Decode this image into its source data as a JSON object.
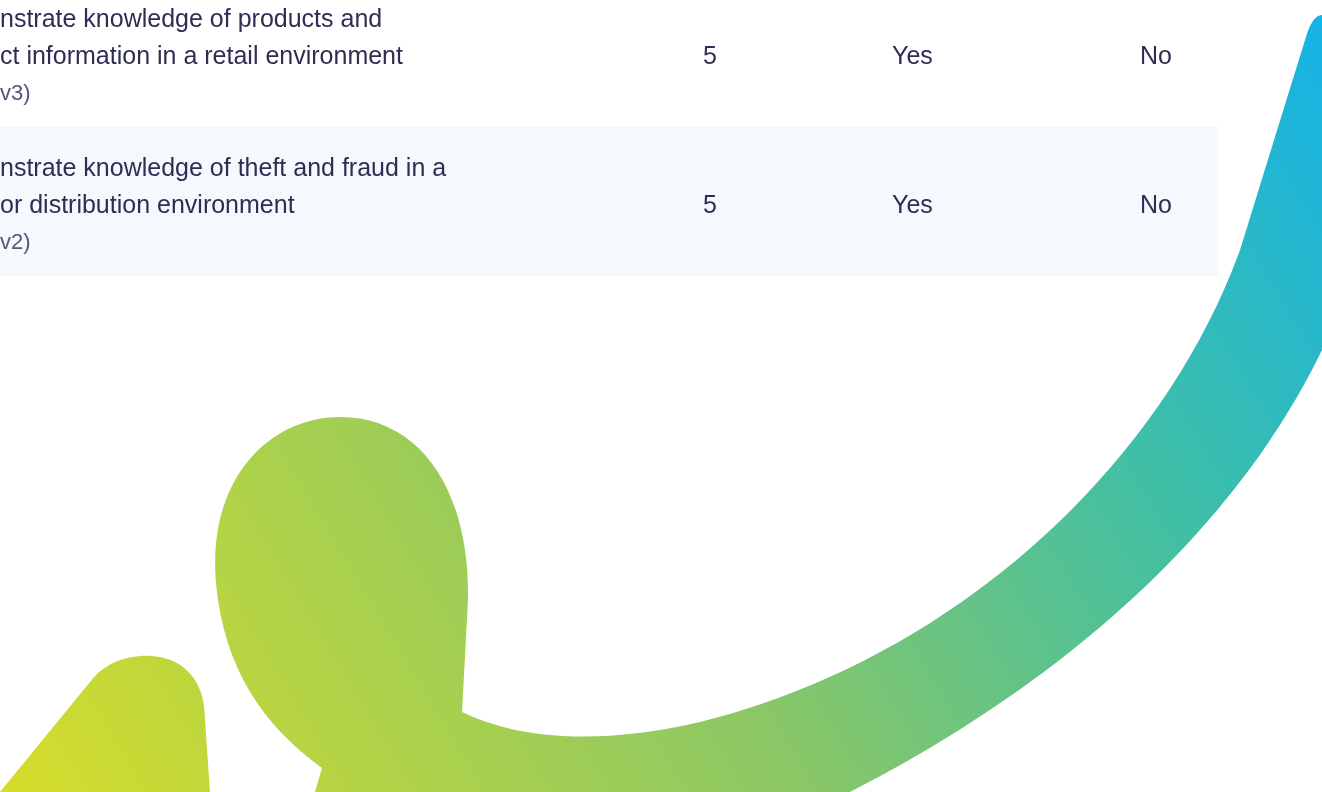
{
  "table": {
    "rows": [
      {
        "title_lines": [
          "nstrate knowledge of products and",
          "ct information in a retail environment"
        ],
        "version": "v3)",
        "column_2": "5",
        "column_3": "Yes",
        "column_4": "No"
      },
      {
        "title_lines": [
          "nstrate knowledge of theft and fraud in a",
          "or distribution environment"
        ],
        "version": "v2)",
        "column_2": "5",
        "column_3": "Yes",
        "column_4": "No"
      }
    ]
  }
}
